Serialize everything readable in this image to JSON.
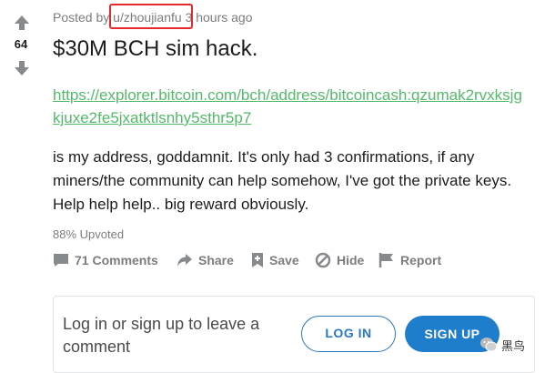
{
  "post": {
    "score": "64",
    "meta_prefix": "Posted by",
    "author": "u/zhoujianfu",
    "time": "3 hours ago",
    "title": "$30M BCH sim hack.",
    "link": "https://explorer.bitcoin.com/bch/address/bitcoincash:qzumak2rvxksjgkjuxe2fe5jxatktlsnhy5sthr5p7",
    "body": "is my address, goddamnit. It's only had 3 confirmations, if any miners/the community can help somehow, I've got the private keys. Help help help.. big reward obviously.",
    "upvoted": "88% Upvoted"
  },
  "actions": {
    "comments": "71 Comments",
    "share": "Share",
    "save": "Save",
    "hide": "Hide",
    "report": "Report"
  },
  "login_card": {
    "prompt": "Log in or sign up to leave a comment",
    "login_label": "LOG IN",
    "signup_label": "SIGN UP"
  },
  "watermark": {
    "text": "黑鸟"
  },
  "colors": {
    "link": "#54b96a",
    "highlight_box": "#e8292b",
    "primary_button": "#1f7ecb",
    "muted_text": "#7c7c7c"
  }
}
